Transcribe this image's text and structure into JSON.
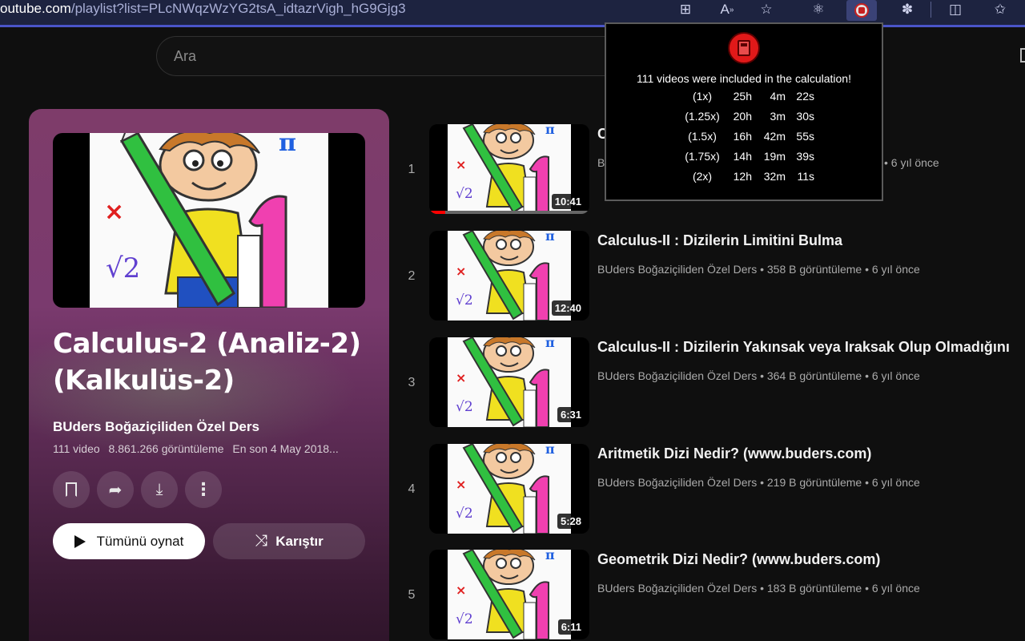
{
  "browser": {
    "url_host": "outube.com",
    "url_path": "/playlist?list=PLcNWqzWzYG2tsA_idtazrVigh_hG9Gjg3"
  },
  "search": {
    "placeholder": "Ara"
  },
  "playlist": {
    "title": "Calculus-2 (Analiz-2) (Kalkulüs-2)",
    "channel": "BUders Boğaziçiliden Özel Ders",
    "video_count": "111 video",
    "views": "8.861.266 görüntüleme",
    "last_updated": "En son 4 May 2018...",
    "play_all_label": "Tümünü oynat",
    "shuffle_label": "Karıştır"
  },
  "popup": {
    "headline": "111 videos were included in the calculation!",
    "rows": [
      {
        "speed": "(1x)",
        "h": "25h",
        "m": "4m",
        "s": "22s"
      },
      {
        "speed": "(1.25x)",
        "h": "20h",
        "m": "3m",
        "s": "30s"
      },
      {
        "speed": "(1.5x)",
        "h": "16h",
        "m": "42m",
        "s": "55s"
      },
      {
        "speed": "(1.75x)",
        "h": "14h",
        "m": "19m",
        "s": "39s"
      },
      {
        "speed": "(2x)",
        "h": "12h",
        "m": "32m",
        "s": "11s"
      }
    ]
  },
  "videos": [
    {
      "index": "1",
      "title": "C",
      "meta": "B",
      "meta_tail": "• 6 yıl önce",
      "duration": "10:41",
      "watched_fraction": 0.1
    },
    {
      "index": "2",
      "title": "Calculus-II : Dizilerin Limitini Bulma",
      "meta": "BUders Boğaziçiliden Özel Ders • 358 B görüntüleme • 6 yıl önce",
      "duration": "12:40"
    },
    {
      "index": "3",
      "title": "Calculus-II : Dizilerin Yakınsak veya Iraksak Olup Olmadığını",
      "meta": "BUders Boğaziçiliden Özel Ders • 364 B görüntüleme • 6 yıl önce",
      "duration": "6:31"
    },
    {
      "index": "4",
      "title": "Aritmetik Dizi Nedir? (www.buders.com)",
      "meta": "BUders Boğaziçiliden Özel Ders • 219 B görüntüleme • 6 yıl önce",
      "duration": "5:28"
    },
    {
      "index": "5",
      "title": "Geometrik Dizi Nedir? (www.buders.com)",
      "meta": "BUders Boğaziçiliden Özel Ders • 183 B görüntüleme • 6 yıl önce",
      "duration": "6:11"
    }
  ]
}
